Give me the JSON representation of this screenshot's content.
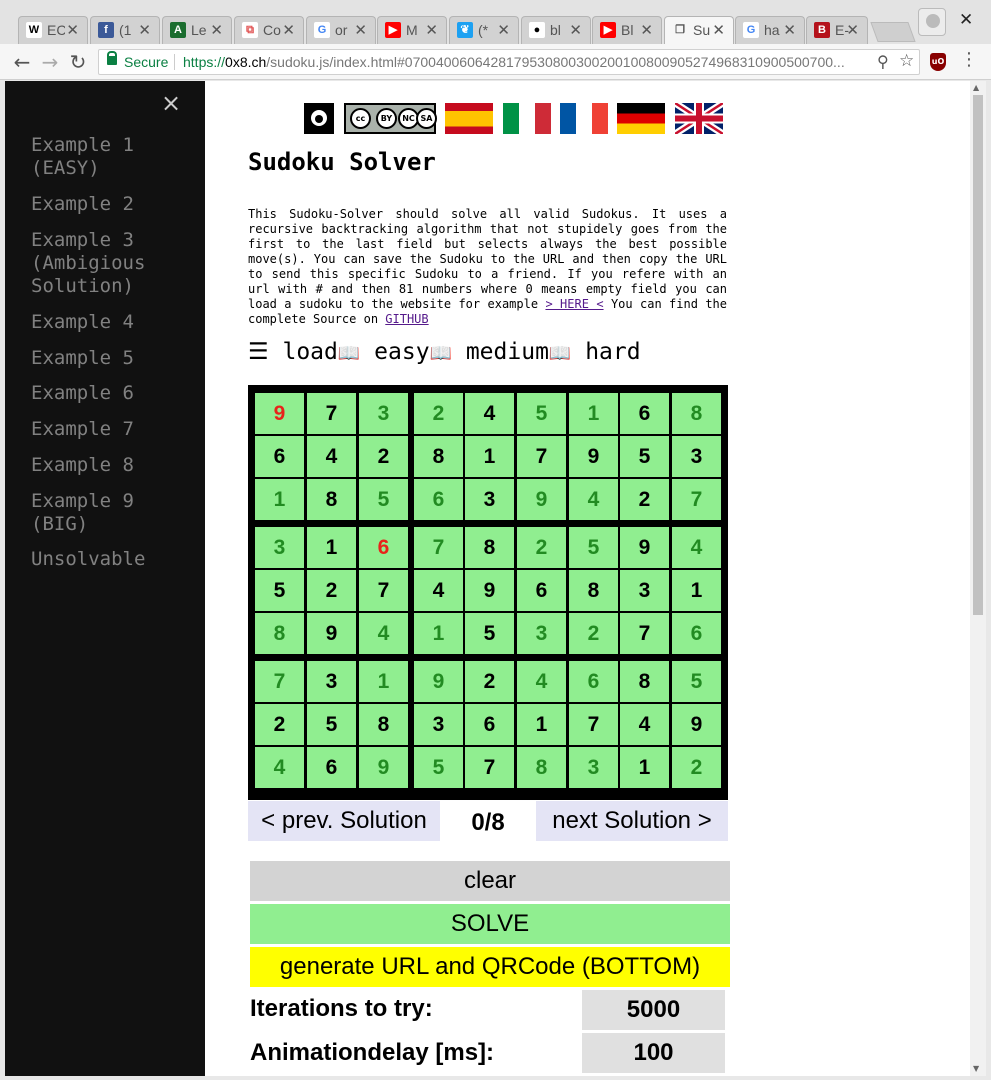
{
  "browser": {
    "tabs": [
      {
        "title": "EC",
        "favicon": "W",
        "favicon_color": "#ffffff",
        "favicon_fg": "#000000"
      },
      {
        "title": "(1",
        "favicon": "f",
        "favicon_color": "#3b5998",
        "favicon_fg": "#ffffff"
      },
      {
        "title": "Le",
        "favicon": "A",
        "favicon_color": "#1b6d2f",
        "favicon_fg": "#ffffff"
      },
      {
        "title": "Co",
        "favicon": "⧉",
        "favicon_color": "#ffffff",
        "favicon_fg": "#e05050"
      },
      {
        "title": "or",
        "favicon": "G",
        "favicon_color": "#ffffff",
        "favicon_fg": "#4285f4"
      },
      {
        "title": "M",
        "favicon": "▶",
        "favicon_color": "#ff0000",
        "favicon_fg": "#ffffff"
      },
      {
        "title": "(*",
        "favicon": "❦",
        "favicon_color": "#1da1f2",
        "favicon_fg": "#ffffff"
      },
      {
        "title": "bl",
        "favicon": "●",
        "favicon_color": "#ffffff",
        "favicon_fg": "#000000"
      },
      {
        "title": "Bl",
        "favicon": "▶",
        "favicon_color": "#ff0000",
        "favicon_fg": "#ffffff"
      },
      {
        "title": "Su",
        "favicon": "❐",
        "favicon_color": "#f6f6f6",
        "favicon_fg": "#555555",
        "active": true
      },
      {
        "title": "ha",
        "favicon": "G",
        "favicon_color": "#ffffff",
        "favicon_fg": "#4285f4"
      },
      {
        "title": "E-",
        "favicon": "B",
        "favicon_color": "#b5121b",
        "favicon_fg": "#ffffff"
      }
    ],
    "security_label": "Secure",
    "url_scheme": "https://",
    "url_host": "0x8.ch",
    "url_rest": "/sudoku.js/index.html#0700400606428179530800300200100800905274968310900500700..."
  },
  "sidenav": {
    "close_label": "×",
    "items": [
      "Example 1\n(EASY)",
      "Example 2",
      "Example 3\n(Ambigious\nSolution)",
      "Example 4",
      "Example 5",
      "Example 6",
      "Example 7",
      "Example 8",
      "Example 9\n(BIG)",
      "Unsolvable"
    ]
  },
  "header": {
    "title": "Sudoku Solver",
    "cc_labels": [
      "BY",
      "NC",
      "SA"
    ],
    "flags": [
      "spain-flag",
      "italy-flag",
      "france-flag",
      "germany-flag",
      "uk-flag"
    ]
  },
  "description": {
    "text": "This Sudoku-Solver should solve all valid Sudokus. It uses a recursive backtracking algorithm that not stupidely goes from the first to the last field but selects always the best possible move(s). You can save the Sudoku to the URL and then copy the URL to send this specific Sudoku to a friend. If you refere with an url with # and then 81 numbers where 0 means empty field you can load a sudoku to the website for example ",
    "here_link": "> HERE <",
    "source_text": " You can find the complete Source on ",
    "github_link": "GITHUB"
  },
  "loadbar": {
    "menu_icon": "☰",
    "load": "load",
    "easy": "easy",
    "medium": "medium",
    "hard": "hard",
    "book_icon": "📖"
  },
  "sudoku": {
    "colors": {
      "given": "#000000",
      "solved": "#228b22",
      "conflict": "#e8231a",
      "cell_bg": "#90ee90"
    },
    "grid": [
      [
        9,
        7,
        3,
        2,
        4,
        5,
        1,
        6,
        8
      ],
      [
        6,
        4,
        2,
        8,
        1,
        7,
        9,
        5,
        3
      ],
      [
        1,
        8,
        5,
        6,
        3,
        9,
        4,
        2,
        7
      ],
      [
        3,
        1,
        6,
        7,
        8,
        2,
        5,
        9,
        4
      ],
      [
        5,
        2,
        7,
        4,
        9,
        6,
        8,
        3,
        1
      ],
      [
        8,
        9,
        4,
        1,
        5,
        3,
        2,
        7,
        6
      ],
      [
        7,
        3,
        1,
        9,
        2,
        4,
        6,
        8,
        5
      ],
      [
        2,
        5,
        8,
        3,
        6,
        1,
        7,
        4,
        9
      ],
      [
        4,
        6,
        9,
        5,
        7,
        8,
        3,
        1,
        2
      ]
    ],
    "types": [
      [
        "r",
        "g",
        "s",
        "s",
        "g",
        "s",
        "s",
        "g",
        "s"
      ],
      [
        "g",
        "g",
        "g",
        "g",
        "g",
        "g",
        "g",
        "g",
        "g"
      ],
      [
        "s",
        "g",
        "s",
        "s",
        "g",
        "s",
        "s",
        "g",
        "s"
      ],
      [
        "s",
        "g",
        "r",
        "s",
        "g",
        "s",
        "s",
        "g",
        "s"
      ],
      [
        "g",
        "g",
        "g",
        "g",
        "g",
        "g",
        "g",
        "g",
        "g"
      ],
      [
        "s",
        "g",
        "s",
        "s",
        "g",
        "s",
        "s",
        "g",
        "s"
      ],
      [
        "s",
        "g",
        "s",
        "s",
        "g",
        "s",
        "s",
        "g",
        "s"
      ],
      [
        "g",
        "g",
        "g",
        "g",
        "g",
        "g",
        "g",
        "g",
        "g"
      ],
      [
        "s",
        "g",
        "s",
        "s",
        "g",
        "s",
        "s",
        "g",
        "s"
      ]
    ]
  },
  "solutions": {
    "prev_label": "< prev. Solution",
    "counter": "0/8",
    "next_label": "next Solution >"
  },
  "actions": {
    "clear": "clear",
    "solve": "SOLVE",
    "generate": "generate URL and QRCode (BOTTOM)"
  },
  "options": {
    "iterations_label": "Iterations to try:",
    "iterations_value": "5000",
    "delay_label": "Animationdelay [ms]:",
    "delay_value": "100"
  }
}
